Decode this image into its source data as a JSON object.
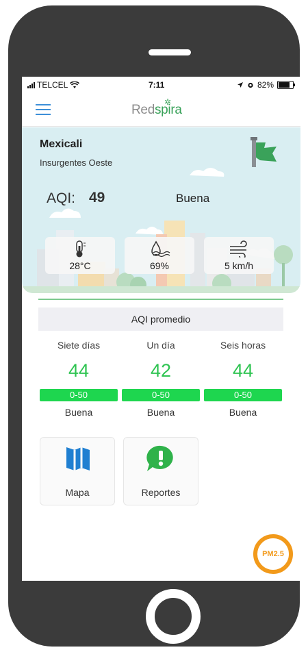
{
  "status_bar": {
    "carrier": "TELCEL",
    "time": "7:11",
    "battery": "82%"
  },
  "header": {
    "brand_prefix": "Red",
    "brand_accent": "spira"
  },
  "location": {
    "city": "Mexicali",
    "station": "Insurgentes Oeste"
  },
  "aqi": {
    "label": "AQI:",
    "value": "49",
    "status": "Buena"
  },
  "metrics": {
    "temperature": "28°C",
    "humidity": "69%",
    "wind": "5 km/h"
  },
  "average": {
    "title": "AQI promedio",
    "columns": [
      {
        "period": "Siete días",
        "value": "44",
        "range": "0-50",
        "quality": "Buena"
      },
      {
        "period": "Un día",
        "value": "42",
        "range": "0-50",
        "quality": "Buena"
      },
      {
        "period": "Seis horas",
        "value": "44",
        "range": "0-50",
        "quality": "Buena"
      }
    ]
  },
  "actions": {
    "map_label": "Mapa",
    "reports_label": "Reportes"
  },
  "fab": {
    "label": "PM2.5"
  },
  "icons": {
    "map": "map-icon",
    "reports": "exclamation-bubble-icon",
    "thermometer": "thermometer-icon",
    "humidity": "humidity-icon",
    "wind": "wind-icon",
    "flag": "flag-icon",
    "menu": "hamburger-icon"
  },
  "colors": {
    "good": "#1ed64f",
    "good_text": "#2fc452",
    "accent": "#3d8fd8",
    "brand_green": "#3aa25a",
    "pm_orange": "#f29a1b"
  }
}
